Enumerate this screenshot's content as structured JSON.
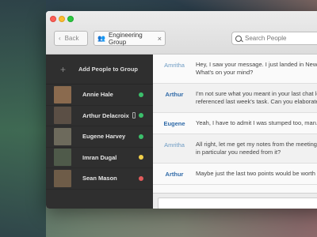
{
  "window": {
    "back_label": "Back",
    "tab_label": "Engineering Group",
    "tab_close": "×",
    "search_placeholder": "Search People"
  },
  "sidebar": {
    "add_label": "Add People to Group",
    "add_icon": "+",
    "people": [
      {
        "name": "Annie Hale",
        "status": "online",
        "status_color": "#3bbf6b",
        "avatar_color": "#8a6a4e"
      },
      {
        "name": "Arthur Delacroix",
        "status": "mobile",
        "status_color": "#3bbf6b",
        "avatar_color": "#5b4f45"
      },
      {
        "name": "Eugene Harvey",
        "status": "online",
        "status_color": "#3bbf6b",
        "avatar_color": "#6d6a5c"
      },
      {
        "name": "Imran Dugal",
        "status": "away",
        "status_color": "#f2d04a",
        "avatar_color": "#4f5a4a"
      },
      {
        "name": "Sean Mason",
        "status": "busy",
        "status_color": "#e25b5b",
        "avatar_color": "#6e5c48"
      }
    ]
  },
  "messages": [
    {
      "author": "Amritha",
      "style": "light",
      "lines": [
        "Hey, I saw your message. I just landed in New York.",
        "What's on your mind?"
      ]
    },
    {
      "author": "Arthur",
      "style": "dark",
      "lines": [
        "I'm not sure what you meant in your last chat log. I",
        "referenced last week's task. Can you elaborate?"
      ]
    },
    {
      "author": "Eugene",
      "style": "dark",
      "lines": [
        "Yeah, I have to admit I was stumped too, man."
      ]
    },
    {
      "author": "Amritha",
      "style": "light",
      "lines": [
        "All right, let me get my notes from the meeting. Anything",
        "in particular you needed from it?"
      ]
    },
    {
      "author": "Arthur",
      "style": "dark",
      "lines": [
        "Maybe just the last two points would be worth reviewing."
      ]
    }
  ],
  "colors": {
    "sidebar_bg": "#2f2f2f",
    "accent_blue": "#2f6aa8",
    "online": "#3bbf6b",
    "away": "#f2d04a",
    "busy": "#e25b5b"
  }
}
